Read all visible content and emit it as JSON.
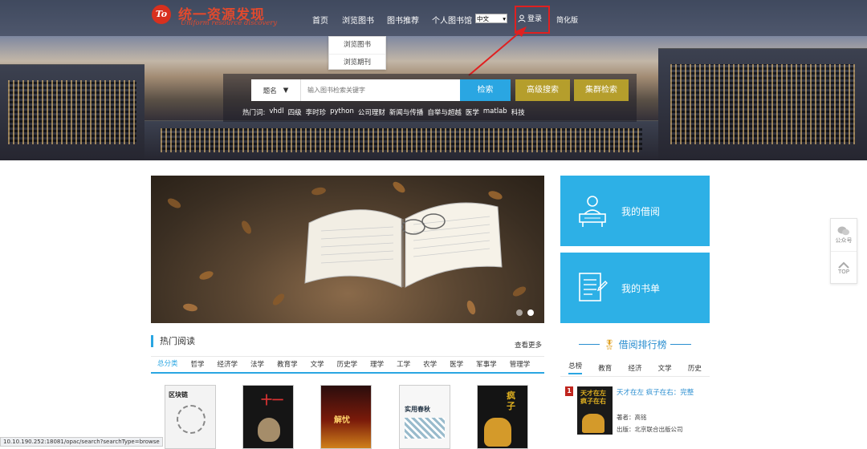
{
  "header": {
    "logo_mark": "To",
    "logo_cn": "统一资源发现",
    "logo_en": "Uniform resource discovery",
    "nav": [
      "首页",
      "浏览图书",
      "图书推荐",
      "个人图书馆"
    ],
    "lang_value": "中文",
    "login_label": "登录",
    "simple_label": "简化版"
  },
  "dropdown": {
    "items": [
      "浏览图书",
      "浏览期刊"
    ]
  },
  "search": {
    "type_label": "题名",
    "placeholder": "输入图书检索关键字",
    "search_btn": "检索",
    "adv_btn": "高级搜索",
    "fed_btn": "集群检索",
    "hot_label": "热门词:",
    "hot_words": [
      "vhdl",
      "四级",
      "李时珍",
      "python",
      "公司理财",
      "新闻与传播",
      "自举与超越",
      "医学",
      "matlab",
      "科技"
    ]
  },
  "side_cards": {
    "borrow_label": "我的借阅",
    "booklist_label": "我的书单"
  },
  "hot_reading": {
    "title": "热门阅读",
    "more": "查看更多",
    "categories": [
      "总分类",
      "哲学",
      "经济学",
      "法学",
      "教育学",
      "文学",
      "历史学",
      "理学",
      "工学",
      "农学",
      "医学",
      "军事学",
      "管理学"
    ],
    "cover_texts": [
      "区块链",
      "十一",
      "解忧",
      "实用春秋",
      "疯子"
    ]
  },
  "ranking": {
    "title": "借阅排行榜",
    "tabs": [
      "总榜",
      "教育",
      "经济",
      "文学",
      "历史"
    ],
    "rank_no": "1",
    "book_title": "天才在左 疯子在右：完整",
    "cover_text": "天才在左 疯子在右",
    "author": "著者：高铭",
    "publisher": "出版：北京联合出版公司"
  },
  "float_panel": {
    "wechat_label": "公众号",
    "top_label": "TOP"
  },
  "status_url": "10.10.190.252:18081/opac/search?searchType=browse",
  "colors": {
    "accent_blue": "#2aa6e2",
    "gold": "#b59e2c",
    "red": "#e02020"
  }
}
